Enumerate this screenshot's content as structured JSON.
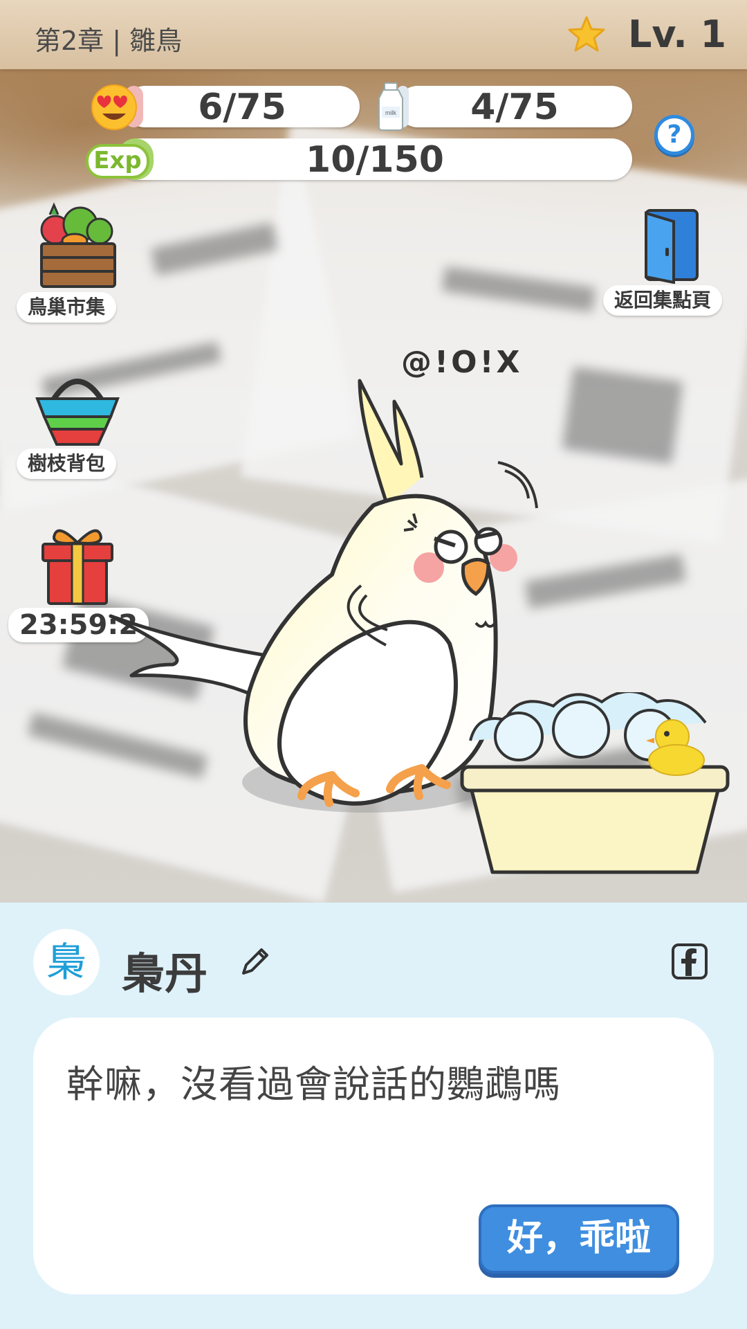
{
  "header": {
    "chapter": "第2章 | 雛鳥",
    "level": "Lv. 1"
  },
  "stats": {
    "love": {
      "text": "6/75",
      "value": 6,
      "max": 75
    },
    "milk": {
      "text": "4/75",
      "value": 4,
      "max": 75,
      "icon_label": "milk"
    },
    "exp": {
      "badge": "Exp",
      "text": "10/150",
      "value": 10,
      "max": 150
    }
  },
  "help_label": "?",
  "side_buttons": {
    "market": "鳥巢市集",
    "backpack": "樹枝背包",
    "gift_timer": "23:59:2",
    "back": "返回集點頁"
  },
  "bird_exclaim": "@!O!X",
  "dialog": {
    "avatar_char": "梟",
    "speaker": "梟丹",
    "text": "幹嘛，沒看過會說話的鸚鵡嗎",
    "ok_button": "好，乖啦"
  },
  "colors": {
    "header": "#d8c0a0",
    "panel": "#dff2fa",
    "button_blue": "#3f8ee0",
    "exp_green": "#8cc23a",
    "bird_yellow": "#fff3b0",
    "cheek": "#f6a3a3"
  }
}
